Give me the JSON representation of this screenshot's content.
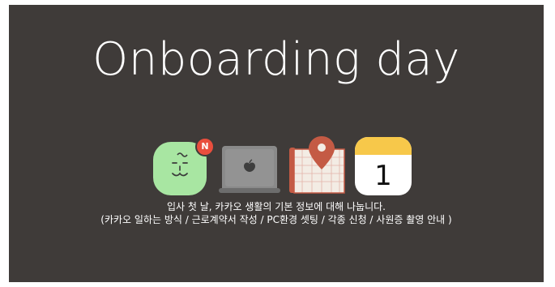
{
  "slide": {
    "title": "Onboarding day",
    "badge": "N",
    "calendar_day": "1",
    "caption_line1": "입사 첫 날, 카카오 생활의 기본 정보에 대해 나눕니다.",
    "caption_line2": "(카카오 일하는 방식 / 근로계약서 작성 / PC환경 셋팅 / 각종 신청 / 사원증 촬영 안내 )"
  },
  "icons": [
    "character-app-icon",
    "laptop-icon",
    "map-pin-icon",
    "calendar-icon"
  ],
  "colors": {
    "background": "#3f3b39",
    "text": "#ffffff",
    "character_green": "#a8e6a2",
    "badge_red": "#e94e3d",
    "laptop_gray": "#8a8a8a",
    "pin_red": "#c45a44",
    "calendar_yellow": "#f7c84a"
  }
}
